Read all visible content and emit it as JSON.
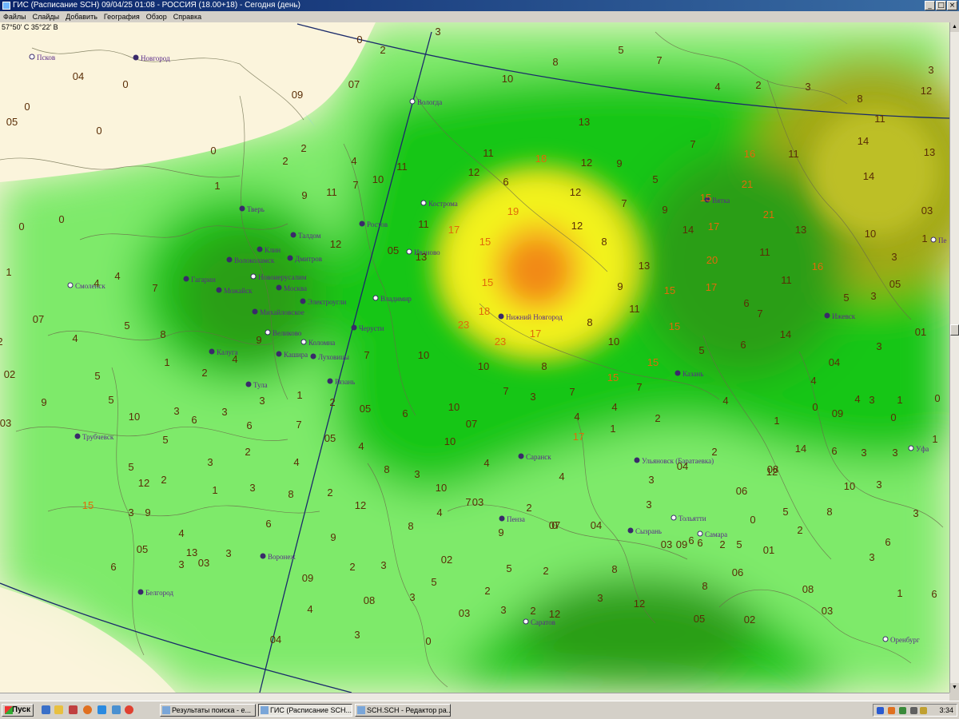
{
  "window": {
    "title": "ГИС (Расписание SCH) 09/04/25 01:08 - РОССИЯ (18.00+18) - Сегодня (день)",
    "minimize_glyph": "_",
    "maximize_glyph": "□",
    "close_glyph": "×"
  },
  "menu": [
    "Файлы",
    "Слайды",
    "Добавить",
    "География",
    "Обзор",
    "Справка"
  ],
  "map": {
    "coordinate_readout": "57°50' С 35°22' В",
    "colors": {
      "land": "#fbf4dc",
      "low": "#7eea6a",
      "mid": "#16c616",
      "high": "#2a9e14",
      "peak_yellow": "#f3f31e",
      "peak_orange": "#f28a12",
      "olive": "#a2a818",
      "value_label": "#5a2d06",
      "value_label_high": "#e06a0a",
      "city_label": "#5a2a8a"
    },
    "cities": [
      {
        "name": "Псков",
        "marker": "open"
      },
      {
        "name": "Новгород",
        "marker": "filled"
      },
      {
        "name": "Вологда",
        "marker": "open"
      },
      {
        "name": "Кострома",
        "marker": "open"
      },
      {
        "name": "Тверь",
        "marker": "filled"
      },
      {
        "name": "Талдом",
        "marker": "filled"
      },
      {
        "name": "Ростов",
        "marker": "filled"
      },
      {
        "name": "Клин",
        "marker": "filled"
      },
      {
        "name": "Дмитров",
        "marker": "filled"
      },
      {
        "name": "Волоколамск",
        "marker": "filled"
      },
      {
        "name": "Иваново",
        "marker": "open"
      },
      {
        "name": "Новоиерусалим",
        "marker": "open"
      },
      {
        "name": "Гагарин",
        "marker": "filled"
      },
      {
        "name": "Смоленск",
        "marker": "open"
      },
      {
        "name": "Можайск",
        "marker": "filled"
      },
      {
        "name": "Москва",
        "marker": "filled"
      },
      {
        "name": "Электроугли",
        "marker": "filled"
      },
      {
        "name": "Владимир",
        "marker": "open"
      },
      {
        "name": "Михайловское",
        "marker": "filled"
      },
      {
        "name": "Нижний Новгород",
        "marker": "filled"
      },
      {
        "name": "Черусти",
        "marker": "filled"
      },
      {
        "name": "Великово",
        "marker": "open"
      },
      {
        "name": "Коломна",
        "marker": "open"
      },
      {
        "name": "Калуга",
        "marker": "filled"
      },
      {
        "name": "Кашира",
        "marker": "filled"
      },
      {
        "name": "Луховицы",
        "marker": "filled"
      },
      {
        "name": "Тула",
        "marker": "filled"
      },
      {
        "name": "Рязань",
        "marker": "filled"
      },
      {
        "name": "Трубчевск",
        "marker": "filled"
      },
      {
        "name": "Вятка",
        "marker": "filled"
      },
      {
        "name": "Ижевск",
        "marker": "filled"
      },
      {
        "name": "Казань",
        "marker": "filled"
      },
      {
        "name": "Саранск",
        "marker": "filled"
      },
      {
        "name": "Ульяновск (Баратаевка)",
        "marker": "filled"
      },
      {
        "name": "Уфа",
        "marker": "open"
      },
      {
        "name": "Пенза",
        "marker": "filled"
      },
      {
        "name": "Тольятти",
        "marker": "open"
      },
      {
        "name": "Сызрань",
        "marker": "filled"
      },
      {
        "name": "Самара",
        "marker": "open"
      },
      {
        "name": "Воронеж",
        "marker": "filled"
      },
      {
        "name": "Белгород",
        "marker": "filled"
      },
      {
        "name": "Саратов",
        "marker": "open"
      },
      {
        "name": "Оренбург",
        "marker": "open"
      },
      {
        "name": "Пе",
        "marker": "open"
      }
    ],
    "value_labels": [
      {
        "v": "3",
        "hot": false
      },
      {
        "v": "0",
        "hot": false
      },
      {
        "v": "2",
        "hot": false
      },
      {
        "v": "8",
        "hot": false
      },
      {
        "v": "5",
        "hot": false
      },
      {
        "v": "7",
        "hot": false
      },
      {
        "v": "04",
        "hot": false
      },
      {
        "v": "0",
        "hot": false
      },
      {
        "v": "0",
        "hot": false
      },
      {
        "v": "05",
        "hot": false
      },
      {
        "v": "0",
        "hot": false
      },
      {
        "v": "09",
        "hot": false
      },
      {
        "v": "07",
        "hot": false
      },
      {
        "v": "10",
        "hot": false
      },
      {
        "v": "13",
        "hot": false
      },
      {
        "v": "4",
        "hot": false
      },
      {
        "v": "2",
        "hot": false
      },
      {
        "v": "3",
        "hot": false
      },
      {
        "v": "3",
        "hot": false
      },
      {
        "v": "12",
        "hot": false
      },
      {
        "v": "8",
        "hot": false
      },
      {
        "v": "11",
        "hot": false
      },
      {
        "v": "0",
        "hot": false
      },
      {
        "v": "2",
        "hot": false
      },
      {
        "v": "2",
        "hot": false
      },
      {
        "v": "4",
        "hot": false
      },
      {
        "v": "11",
        "hot": false
      },
      {
        "v": "11",
        "hot": false
      },
      {
        "v": "18",
        "hot": true
      },
      {
        "v": "12",
        "hot": false
      },
      {
        "v": "9",
        "hot": false
      },
      {
        "v": "7",
        "hot": false
      },
      {
        "v": "16",
        "hot": true
      },
      {
        "v": "11",
        "hot": false
      },
      {
        "v": "14",
        "hot": false
      },
      {
        "v": "13",
        "hot": false
      },
      {
        "v": "1",
        "hot": false
      },
      {
        "v": "9",
        "hot": false
      },
      {
        "v": "11",
        "hot": false
      },
      {
        "v": "7",
        "hot": false
      },
      {
        "v": "10",
        "hot": false
      },
      {
        "v": "12",
        "hot": false
      },
      {
        "v": "6",
        "hot": false
      },
      {
        "v": "12",
        "hot": false
      },
      {
        "v": "5",
        "hot": false
      },
      {
        "v": "15",
        "hot": true
      },
      {
        "v": "21",
        "hot": true
      },
      {
        "v": "14",
        "hot": false
      },
      {
        "v": "19",
        "hot": true
      },
      {
        "v": "7",
        "hot": false
      },
      {
        "v": "9",
        "hot": false
      },
      {
        "v": "21",
        "hot": true
      },
      {
        "v": "03",
        "hot": false
      },
      {
        "v": "0",
        "hot": false
      },
      {
        "v": "0",
        "hot": false
      },
      {
        "v": "11",
        "hot": false
      },
      {
        "v": "17",
        "hot": true
      },
      {
        "v": "12",
        "hot": false
      },
      {
        "v": "14",
        "hot": false
      },
      {
        "v": "17",
        "hot": true
      },
      {
        "v": "13",
        "hot": false
      },
      {
        "v": "10",
        "hot": false
      },
      {
        "v": "1",
        "hot": false
      },
      {
        "v": "12",
        "hot": false
      },
      {
        "v": "05",
        "hot": false
      },
      {
        "v": "15",
        "hot": true
      },
      {
        "v": "8",
        "hot": false
      },
      {
        "v": "20",
        "hot": true
      },
      {
        "v": "11",
        "hot": false
      },
      {
        "v": "3",
        "hot": false
      },
      {
        "v": "13",
        "hot": false
      },
      {
        "v": "16",
        "hot": true
      },
      {
        "v": "4",
        "hot": false
      },
      {
        "v": "7",
        "hot": false
      },
      {
        "v": "15",
        "hot": true
      },
      {
        "v": "13",
        "hot": false
      },
      {
        "v": "9",
        "hot": false
      },
      {
        "v": "15",
        "hot": true
      },
      {
        "v": "17",
        "hot": true
      },
      {
        "v": "11",
        "hot": false
      },
      {
        "v": "05",
        "hot": false
      },
      {
        "v": "1",
        "hot": false
      },
      {
        "v": "4",
        "hot": false
      },
      {
        "v": "18",
        "hot": true
      },
      {
        "v": "11",
        "hot": false
      },
      {
        "v": "8",
        "hot": false
      },
      {
        "v": "6",
        "hot": false
      },
      {
        "v": "5",
        "hot": false
      },
      {
        "v": "3",
        "hot": false
      },
      {
        "v": "07",
        "hot": false
      },
      {
        "v": "5",
        "hot": false
      },
      {
        "v": "8",
        "hot": false
      },
      {
        "v": "23",
        "hot": true
      },
      {
        "v": "17",
        "hot": true
      },
      {
        "v": "15",
        "hot": true
      },
      {
        "v": "7",
        "hot": false
      },
      {
        "v": "14",
        "hot": false
      },
      {
        "v": "01",
        "hot": false
      },
      {
        "v": "9",
        "hot": false
      },
      {
        "v": "23",
        "hot": true
      },
      {
        "v": "10",
        "hot": false
      },
      {
        "v": "6",
        "hot": false
      },
      {
        "v": "5",
        "hot": false
      },
      {
        "v": "3",
        "hot": false
      },
      {
        "v": "04",
        "hot": false
      },
      {
        "v": "2",
        "hot": false
      },
      {
        "v": "4",
        "hot": false
      },
      {
        "v": "10",
        "hot": false
      },
      {
        "v": "8",
        "hot": false
      },
      {
        "v": "15",
        "hot": true
      },
      {
        "v": "10",
        "hot": false
      },
      {
        "v": "7",
        "hot": false
      },
      {
        "v": "02",
        "hot": false
      },
      {
        "v": "4",
        "hot": false
      },
      {
        "v": "1",
        "hot": false
      },
      {
        "v": "2",
        "hot": false
      },
      {
        "v": "5",
        "hot": false
      },
      {
        "v": "15",
        "hot": true
      },
      {
        "v": "7",
        "hot": false
      },
      {
        "v": "4",
        "hot": false
      },
      {
        "v": "3",
        "hot": false
      },
      {
        "v": "1",
        "hot": false
      },
      {
        "v": "2",
        "hot": false
      },
      {
        "v": "05",
        "hot": false
      },
      {
        "v": "6",
        "hot": false
      },
      {
        "v": "10",
        "hot": false
      },
      {
        "v": "7",
        "hot": false
      },
      {
        "v": "3",
        "hot": false
      },
      {
        "v": "7",
        "hot": false
      },
      {
        "v": "4",
        "hot": false
      },
      {
        "v": "4",
        "hot": false
      },
      {
        "v": "1",
        "hot": false
      },
      {
        "v": "0",
        "hot": false
      },
      {
        "v": "09",
        "hot": false
      },
      {
        "v": "4",
        "hot": false
      },
      {
        "v": "3",
        "hot": false
      },
      {
        "v": "1",
        "hot": false
      },
      {
        "v": "0",
        "hot": false
      },
      {
        "v": "5",
        "hot": false
      },
      {
        "v": "10",
        "hot": false
      },
      {
        "v": "9",
        "hot": false
      },
      {
        "v": "3",
        "hot": false
      },
      {
        "v": "6",
        "hot": false
      },
      {
        "v": "3",
        "hot": false
      },
      {
        "v": "6",
        "hot": false
      },
      {
        "v": "7",
        "hot": false
      },
      {
        "v": "07",
        "hot": false
      },
      {
        "v": "4",
        "hot": false
      },
      {
        "v": "1",
        "hot": false
      },
      {
        "v": "2",
        "hot": false
      },
      {
        "v": "0",
        "hot": false
      },
      {
        "v": "05",
        "hot": false
      },
      {
        "v": "4",
        "hot": false
      },
      {
        "v": "10",
        "hot": false
      },
      {
        "v": "17",
        "hot": true
      },
      {
        "v": "14",
        "hot": false
      },
      {
        "v": "6",
        "hot": false
      },
      {
        "v": "3",
        "hot": false
      },
      {
        "v": "3",
        "hot": false
      },
      {
        "v": "1",
        "hot": false
      },
      {
        "v": "5",
        "hot": false
      },
      {
        "v": "2",
        "hot": false
      },
      {
        "v": "4",
        "hot": false
      },
      {
        "v": "8",
        "hot": false
      },
      {
        "v": "3",
        "hot": false
      },
      {
        "v": "4",
        "hot": false
      },
      {
        "v": "4",
        "hot": false
      },
      {
        "v": "3",
        "hot": false
      },
      {
        "v": "04",
        "hot": false
      },
      {
        "v": "2",
        "hot": false
      },
      {
        "v": "08",
        "hot": false
      },
      {
        "v": "03",
        "hot": false
      },
      {
        "v": "3",
        "hot": false
      },
      {
        "v": "5",
        "hot": false
      },
      {
        "v": "12",
        "hot": false
      },
      {
        "v": "2",
        "hot": false
      },
      {
        "v": "10",
        "hot": false
      },
      {
        "v": "3",
        "hot": false
      },
      {
        "v": "1",
        "hot": false
      },
      {
        "v": "3",
        "hot": false
      },
      {
        "v": "8",
        "hot": false
      },
      {
        "v": "2",
        "hot": false
      },
      {
        "v": "10",
        "hot": false
      },
      {
        "v": "7",
        "hot": false
      },
      {
        "v": "2",
        "hot": false
      },
      {
        "v": "3",
        "hot": false
      },
      {
        "v": "06",
        "hot": false
      },
      {
        "v": "12",
        "hot": false
      },
      {
        "v": "8",
        "hot": false
      },
      {
        "v": "15",
        "hot": true
      },
      {
        "v": "3",
        "hot": false
      },
      {
        "v": "9",
        "hot": false
      },
      {
        "v": "12",
        "hot": false
      },
      {
        "v": "4",
        "hot": false
      },
      {
        "v": "03",
        "hot": false
      },
      {
        "v": "07",
        "hot": false
      },
      {
        "v": "04",
        "hot": false
      },
      {
        "v": "0",
        "hot": false
      },
      {
        "v": "5",
        "hot": false
      },
      {
        "v": "2",
        "hot": false
      },
      {
        "v": "3",
        "hot": false
      },
      {
        "v": "4",
        "hot": false
      },
      {
        "v": "6",
        "hot": false
      },
      {
        "v": "9",
        "hot": false
      },
      {
        "v": "8",
        "hot": false
      },
      {
        "v": "9",
        "hot": false
      },
      {
        "v": "0",
        "hot": false
      },
      {
        "v": "03",
        "hot": false
      },
      {
        "v": "09",
        "hot": false
      },
      {
        "v": "6",
        "hot": false
      },
      {
        "v": "6",
        "hot": false
      },
      {
        "v": "2",
        "hot": false
      },
      {
        "v": "5",
        "hot": false
      },
      {
        "v": "6",
        "hot": false
      },
      {
        "v": "3",
        "hot": false
      },
      {
        "v": "13",
        "hot": false
      },
      {
        "v": "05",
        "hot": false
      },
      {
        "v": "02",
        "hot": false
      },
      {
        "v": "2",
        "hot": false
      },
      {
        "v": "3",
        "hot": false
      },
      {
        "v": "5",
        "hot": false
      },
      {
        "v": "2",
        "hot": false
      },
      {
        "v": "8",
        "hot": false
      },
      {
        "v": "01",
        "hot": false
      },
      {
        "v": "3",
        "hot": false
      },
      {
        "v": "6",
        "hot": false
      },
      {
        "v": "3",
        "hot": false
      },
      {
        "v": "03",
        "hot": false
      },
      {
        "v": "09",
        "hot": false
      },
      {
        "v": "5",
        "hot": false
      },
      {
        "v": "08",
        "hot": false
      },
      {
        "v": "2",
        "hot": false
      },
      {
        "v": "3",
        "hot": false
      },
      {
        "v": "12",
        "hot": false
      },
      {
        "v": "8",
        "hot": false
      },
      {
        "v": "1",
        "hot": false
      },
      {
        "v": "06",
        "hot": false
      },
      {
        "v": "6",
        "hot": false
      },
      {
        "v": "4",
        "hot": false
      },
      {
        "v": "08",
        "hot": false
      },
      {
        "v": "3",
        "hot": false
      },
      {
        "v": "03",
        "hot": false
      },
      {
        "v": "3",
        "hot": false
      },
      {
        "v": "2",
        "hot": false
      },
      {
        "v": "12",
        "hot": false
      },
      {
        "v": "05",
        "hot": false
      },
      {
        "v": "02",
        "hot": false
      },
      {
        "v": "03",
        "hot": false
      },
      {
        "v": "04",
        "hot": false
      },
      {
        "v": "3",
        "hot": false
      },
      {
        "v": "0",
        "hot": false
      }
    ]
  },
  "taskbar": {
    "start": "Пуск",
    "tasks": [
      {
        "label": "Результаты поиска - е..."
      },
      {
        "label": "ГИС (Расписание SCH..."
      },
      {
        "label": "SCH.SCH - Редактор ра..."
      }
    ],
    "clock": "3:34"
  }
}
